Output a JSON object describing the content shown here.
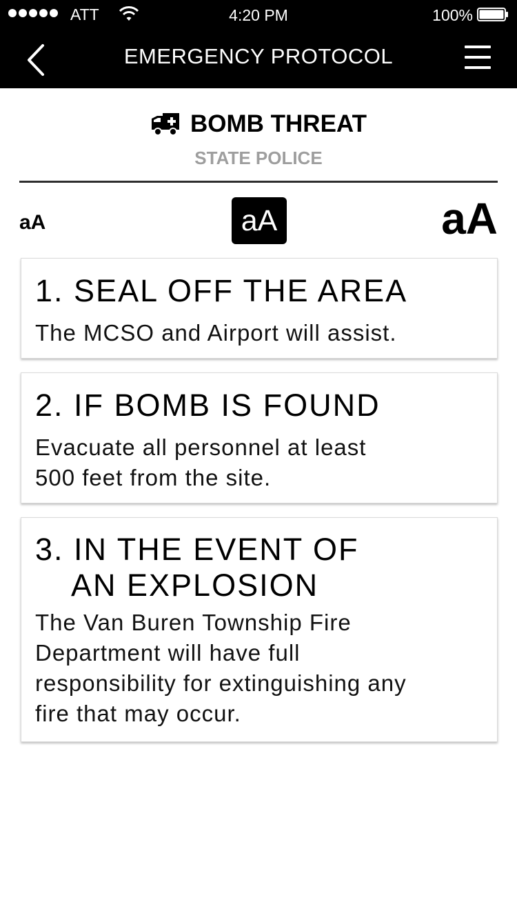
{
  "status_bar": {
    "carrier": "ATT",
    "time": "4:20 PM",
    "battery": "100%"
  },
  "nav": {
    "title": "EMERGENCY PROTOCOL",
    "back_icon": "chevron-left-icon",
    "menu_icon": "hamburger-menu-icon"
  },
  "header": {
    "icon": "ambulance-icon",
    "title": "BOMB THREAT",
    "subtitle": "STATE POLICE"
  },
  "font_size": {
    "small": "aA",
    "medium": "aA",
    "large": "aA",
    "selected": "medium"
  },
  "steps": [
    {
      "number": "1",
      "title": "SEAL OFF THE AREA",
      "text": "The MCSO and Airport will assist."
    },
    {
      "number": "2",
      "title": "IF BOMB IS FOUND",
      "text_line1": "Evacuate all personnel at least",
      "text_line2": "500 feet from the site."
    },
    {
      "number": "3",
      "title_line1": "IN THE EVENT OF",
      "title_line2": "AN EXPLOSION",
      "text_line1": "The Van Buren Township Fire",
      "text_line2": "Department will have full",
      "text_line3": "responsibility for extinguishing any",
      "text_line4": "fire that may occur."
    }
  ],
  "colors": {
    "bar": "#000000",
    "subtitle": "#9e9e9e"
  }
}
